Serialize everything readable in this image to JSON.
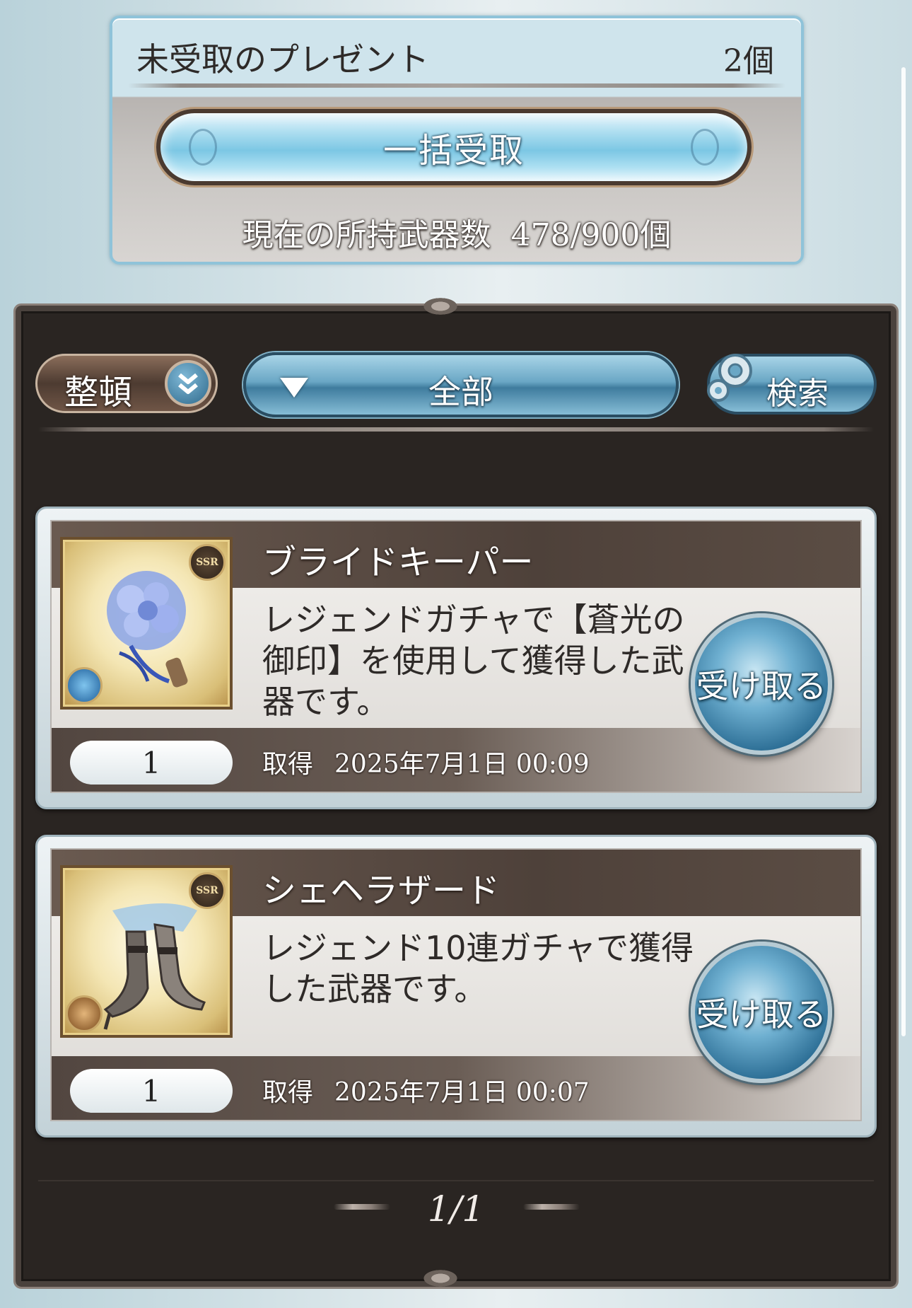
{
  "top_panel": {
    "title": "未受取のプレゼント",
    "count": "2個",
    "bulk_receive_label": "一括受取",
    "weapon_count_label": "現在の所持武器数",
    "weapon_count_value": "478/900個"
  },
  "toolbar": {
    "sort_label": "整頓",
    "filter_label": "全部",
    "search_label": "検索"
  },
  "items": [
    {
      "name": "ブライドキーパー",
      "description": "レジェンドガチャで【蒼光の御印】を使用して獲得した武器です。",
      "rarity": "SSR",
      "element_icon": "water-icon",
      "quantity": "1",
      "obtained_label": "取得",
      "obtained_date": "2025年7月1日 00:09",
      "claim_label": "受け取る"
    },
    {
      "name": "シェヘラザード",
      "description": "レジェンド10連ガチャで獲得した武器です。",
      "rarity": "SSR",
      "element_icon": "earth-icon",
      "quantity": "1",
      "obtained_label": "取得",
      "obtained_date": "2025年7月1日 00:07",
      "claim_label": "受け取る"
    }
  ],
  "pagination": {
    "page": "1/1"
  },
  "colors": {
    "frame_bg": "#2a2522",
    "accent_blue": "#6aa7c5",
    "panel_border": "#8fc3d9"
  }
}
